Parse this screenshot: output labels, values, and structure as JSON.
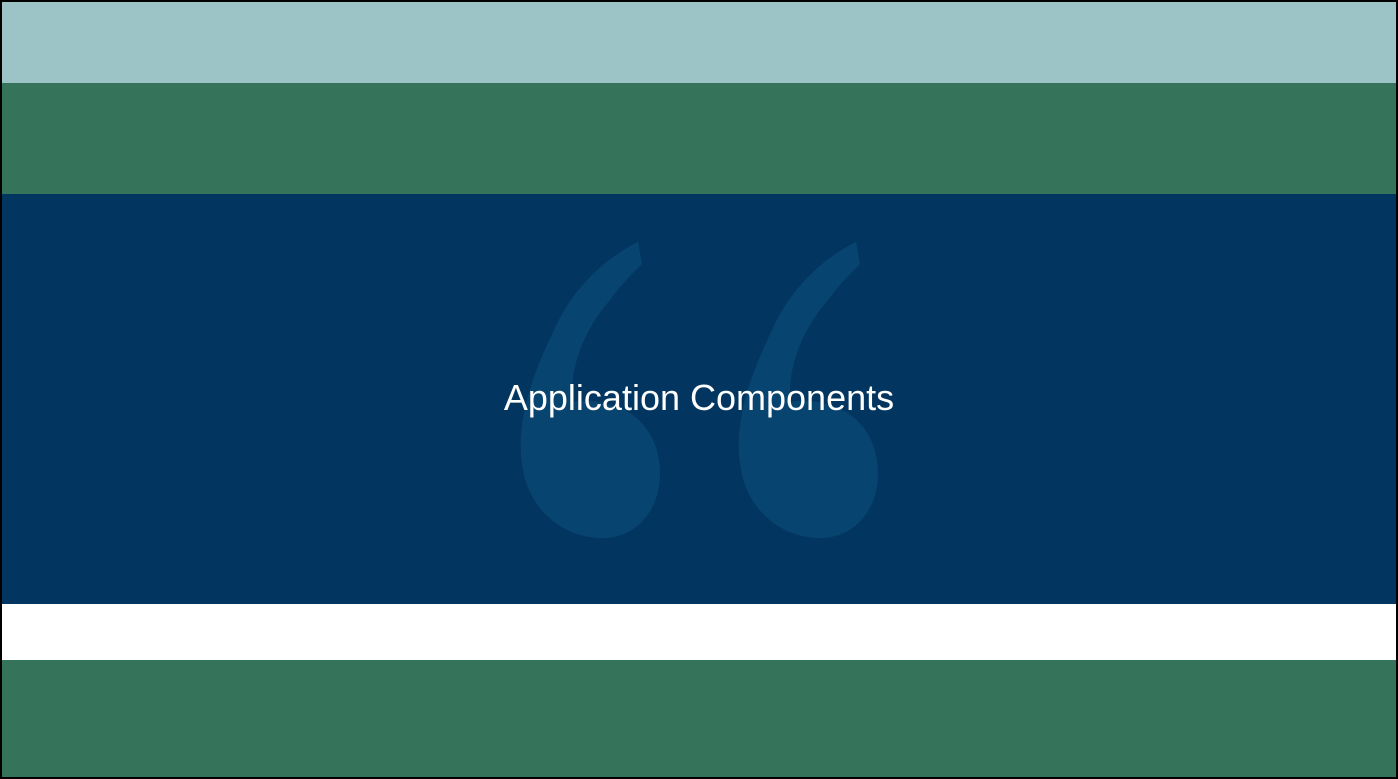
{
  "slide": {
    "title": "Application Components"
  },
  "decoration": {
    "quote_icon": "opening-double-quote-icon"
  },
  "colors": {
    "top_band": "#9cc3c6",
    "green_band": "#35735a",
    "navy_band": "#023660",
    "white_band": "#ffffff",
    "quote_mark": "#07446f",
    "title_text": "#ffffff"
  }
}
